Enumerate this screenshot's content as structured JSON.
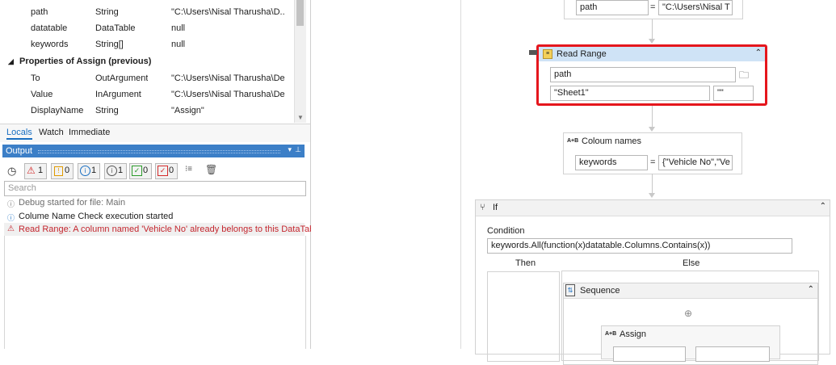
{
  "properties": {
    "rows": [
      {
        "name": "path",
        "type": "String",
        "value": "\"C:\\Users\\Nisal Tharusha\\D..."
      },
      {
        "name": "datatable",
        "type": "DataTable",
        "value": "null"
      },
      {
        "name": "keywords",
        "type": "String[]",
        "value": "null"
      }
    ],
    "group_label": "Properties of Assign (previous)",
    "group_rows": [
      {
        "name": "To",
        "type": "OutArgument",
        "value": "\"C:\\Users\\Nisal Tharusha\\Desk"
      },
      {
        "name": "Value",
        "type": "InArgument",
        "value": "\"C:\\Users\\Nisal Tharusha\\Desk"
      },
      {
        "name": "DisplayName",
        "type": "String",
        "value": "\"Assign\""
      }
    ]
  },
  "tabs": [
    "Locals",
    "Watch",
    "Immediate"
  ],
  "output": {
    "title": "Output",
    "counts": {
      "error": "1",
      "warning": "0",
      "info": "1",
      "trace": "1",
      "success": "0",
      "failure": "0"
    },
    "search_placeholder": "Search",
    "logs": [
      {
        "type": "info",
        "text": "Debug started for file: Main"
      },
      {
        "type": "info",
        "text": "Colume Name Check execution started"
      },
      {
        "type": "error",
        "text": "Read Range: A column named 'Vehicle No' already belongs to this DataTable."
      }
    ]
  },
  "designer": {
    "assign_top": {
      "to": "path",
      "eq": "=",
      "value": "\"C:\\Users\\Nisal Tha"
    },
    "read_range": {
      "title": "Read Range",
      "path": "path",
      "sheet": "\"Sheet1\"",
      "range": "\"\""
    },
    "coloum": {
      "title": "Coloum names",
      "to": "keywords",
      "eq": "=",
      "value": "{\"Vehicle No\",\"Vehi"
    },
    "if": {
      "title": "If",
      "condition_label": "Condition",
      "condition": "keywords.All(function(x)datatable.Columns.Contains(x))",
      "then": "Then",
      "else": "Else"
    },
    "sequence": {
      "title": "Sequence"
    },
    "assign": {
      "title": "Assign"
    },
    "ab_badge": "A+B"
  },
  "colors": {
    "highlight": "#e5161d",
    "read_range_header": "#cfe3f6",
    "output_header": "#3c7fc7",
    "error_text": "#c4262e"
  }
}
